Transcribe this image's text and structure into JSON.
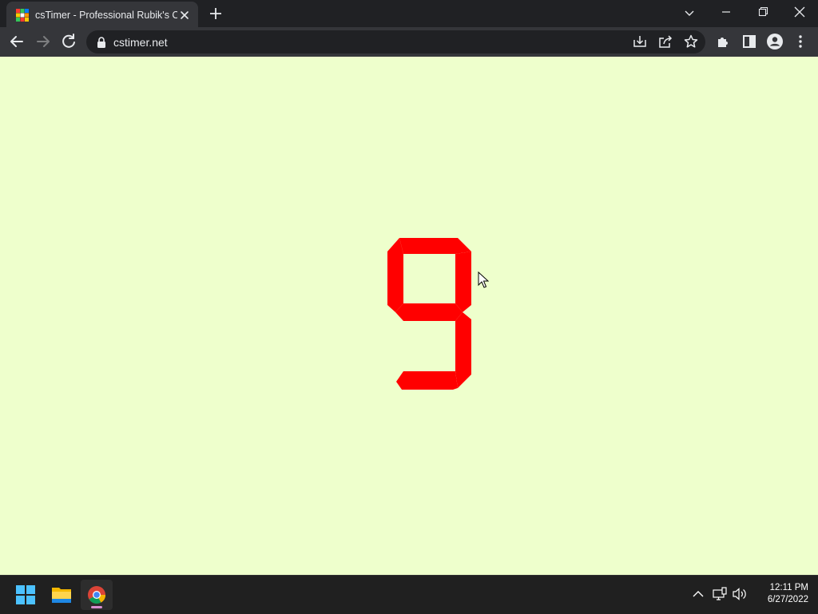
{
  "browser": {
    "tab": {
      "title": "csTimer - Professional Rubik's Cube Speedsolving/Training Timer"
    },
    "address_bar": {
      "url": "cstimer.net"
    }
  },
  "page": {
    "background_color": "#eeffcc",
    "timer_display": {
      "value": "9",
      "color": "#ff0000"
    }
  },
  "taskbar": {
    "clock": {
      "time": "12:11 PM",
      "date": "6/27/2022"
    }
  },
  "icons": {
    "tab_favicon": "cstimer-favicon-icon",
    "close_tab": "close-icon",
    "new_tab": "plus-icon",
    "back": "back-arrow-icon",
    "forward": "forward-arrow-icon",
    "reload": "reload-icon",
    "install": "install-icon",
    "share": "share-icon",
    "bookmark": "star-icon",
    "extensions": "puzzle-icon",
    "side_panel": "side-panel-icon",
    "profile": "profile-icon",
    "menu": "kebab-menu-icon"
  }
}
